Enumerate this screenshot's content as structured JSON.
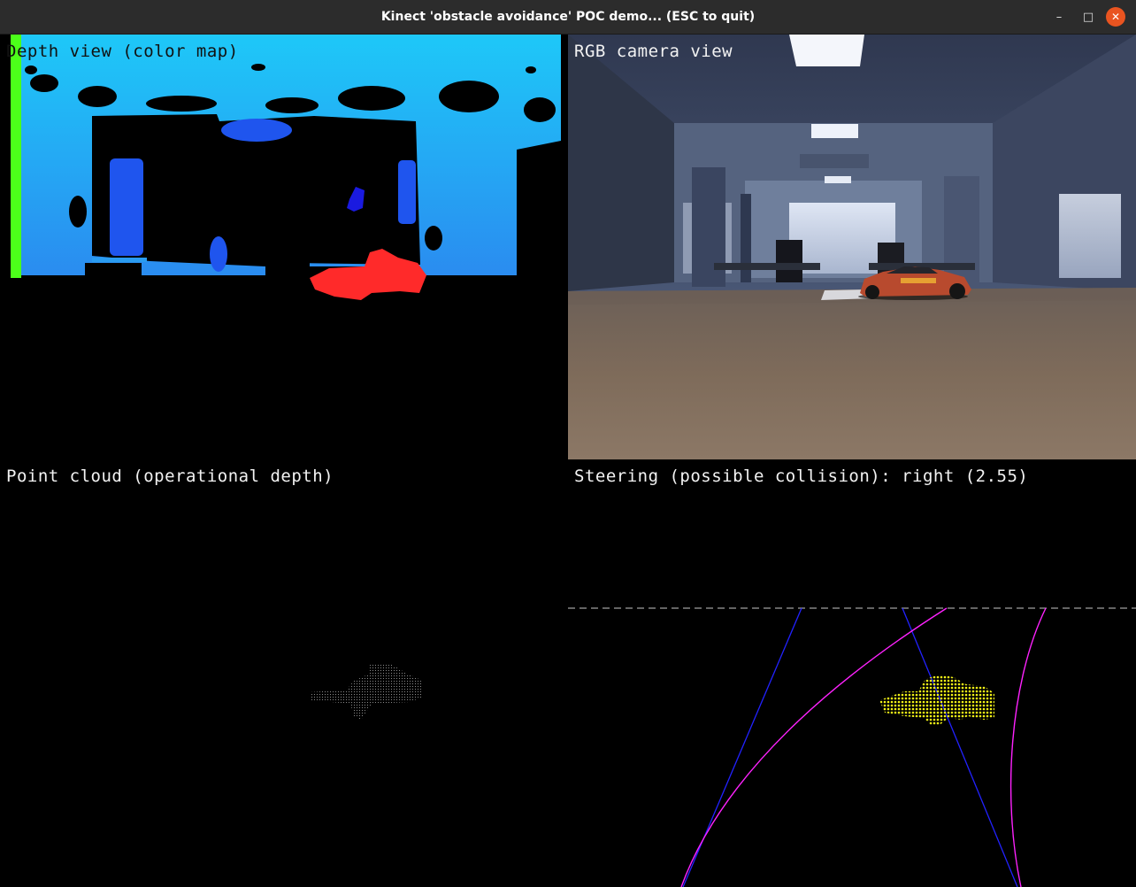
{
  "window": {
    "title": "Kinect 'obstacle avoidance' POC demo... (ESC to quit)",
    "controls": {
      "minimize_glyph": "–",
      "maximize_glyph": "□",
      "close_glyph": "✕"
    }
  },
  "panels": {
    "depth": {
      "label": "Depth view (color map)"
    },
    "rgb": {
      "label": "RGB camera view"
    },
    "point_cloud": {
      "label": "Point cloud (operational depth)"
    },
    "steering": {
      "label": "Steering (possible collision): right (2.55)"
    }
  },
  "colors": {
    "titlebar": "#2c2c2c",
    "close_button": "#e95420",
    "depth_near": "#ff2a2a",
    "depth_mid": "#2255ee",
    "depth_far": "#1ea8f0",
    "depth_edge": "#4cff1a",
    "steer_boundary": "#2222ff",
    "steer_path": "#ff22ff",
    "steer_obstacle": "#ffff22",
    "steer_limit": "#c8c8c8"
  }
}
